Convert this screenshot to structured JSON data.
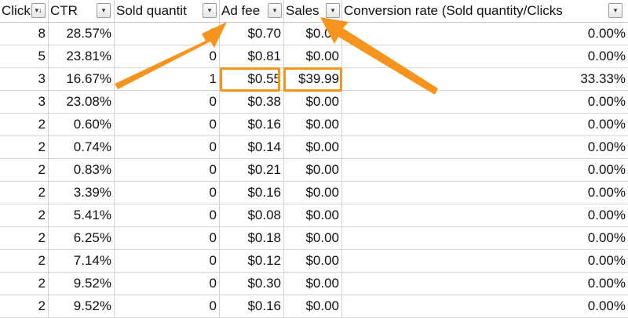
{
  "headers": [
    {
      "label": "Click",
      "filter_glyph": "▾↓"
    },
    {
      "label": "CTR",
      "filter_glyph": "▾"
    },
    {
      "label": "Sold quantit",
      "filter_glyph": "▾"
    },
    {
      "label": "Ad fee",
      "filter_glyph": "▾"
    },
    {
      "label": "Sales",
      "filter_glyph": "▾"
    },
    {
      "label": "Conversion rate (Sold quantity/Clicks",
      "filter_glyph": "▾"
    }
  ],
  "rows": [
    [
      "8",
      "28.57%",
      "0",
      "$0.70",
      "$0.00",
      "0.00%"
    ],
    [
      "5",
      "23.81%",
      "0",
      "$0.81",
      "$0.00",
      "0.00%"
    ],
    [
      "3",
      "16.67%",
      "1",
      "$0.55",
      "$39.99",
      "33.33%"
    ],
    [
      "3",
      "23.08%",
      "0",
      "$0.38",
      "$0.00",
      "0.00%"
    ],
    [
      "2",
      "0.60%",
      "0",
      "$0.16",
      "$0.00",
      "0.00%"
    ],
    [
      "2",
      "0.74%",
      "0",
      "$0.14",
      "$0.00",
      "0.00%"
    ],
    [
      "2",
      "0.83%",
      "0",
      "$0.21",
      "$0.00",
      "0.00%"
    ],
    [
      "2",
      "3.39%",
      "0",
      "$0.16",
      "$0.00",
      "0.00%"
    ],
    [
      "2",
      "5.41%",
      "0",
      "$0.08",
      "$0.00",
      "0.00%"
    ],
    [
      "2",
      "6.25%",
      "0",
      "$0.18",
      "$0.00",
      "0.00%"
    ],
    [
      "2",
      "7.14%",
      "0",
      "$0.12",
      "$0.00",
      "0.00%"
    ],
    [
      "2",
      "9.52%",
      "0",
      "$0.30",
      "$0.00",
      "0.00%"
    ],
    [
      "2",
      "9.52%",
      "0",
      "$0.16",
      "$0.00",
      "0.00%"
    ]
  ],
  "highlighted_row_index": 2,
  "highlighted_columns": [
    3,
    4
  ],
  "colors": {
    "annotation": "#f7941d",
    "grid": "#d4d4d4"
  }
}
